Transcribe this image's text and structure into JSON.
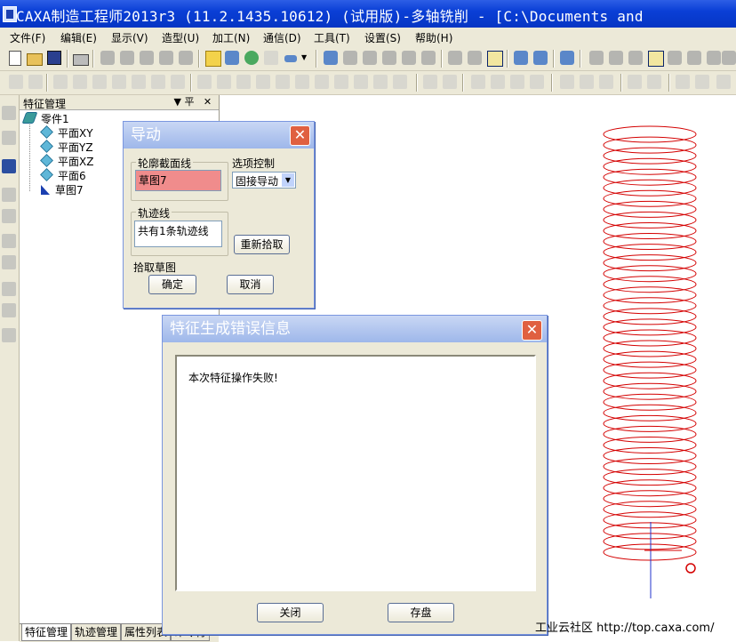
{
  "window": {
    "title": "CAXA制造工程师2013r3 (11.2.1435.10612) (试用版)-多轴铣削 - [C:\\Documents and"
  },
  "menubar": {
    "items": [
      "文件(F)",
      "编辑(E)",
      "显示(V)",
      "造型(U)",
      "加工(N)",
      "通信(D)",
      "工具(T)",
      "设置(S)",
      "帮助(H)"
    ]
  },
  "feature_panel": {
    "title": "特征管理",
    "pin_label": "▼ 平",
    "close_label": "✕",
    "tree": {
      "root": "零件1",
      "children": [
        "平面XY",
        "平面YZ",
        "平面XZ",
        "平面6",
        "草图7"
      ]
    },
    "tabs": [
      "特征管理",
      "轨迹管理",
      "属性列表",
      "命令行"
    ]
  },
  "sweep_dialog": {
    "title": "导动",
    "close_symbol": "✕",
    "profile_group_label": "轮廓截面线",
    "profile_value": "草图7",
    "options_label": "选项控制",
    "options_value": "固接导动",
    "trajectory_group_label": "轨迹线",
    "trajectory_value": "共有1条轨迹线",
    "repick_button": "重新拾取",
    "status_text": "拾取草图",
    "ok_button": "确定",
    "cancel_button": "取消"
  },
  "error_dialog": {
    "title": "特征生成错误信息",
    "close_symbol": "✕",
    "message": "本次特征操作失败!",
    "close_button": "关闭",
    "save_button": "存盘"
  },
  "watermark": "工业云社区 http://top.caxa.com/",
  "colors": {
    "title_bar": "#0a3fd6",
    "helix": "#d40000",
    "profile_field": "#f08c8c",
    "axis": "#2233cc"
  }
}
